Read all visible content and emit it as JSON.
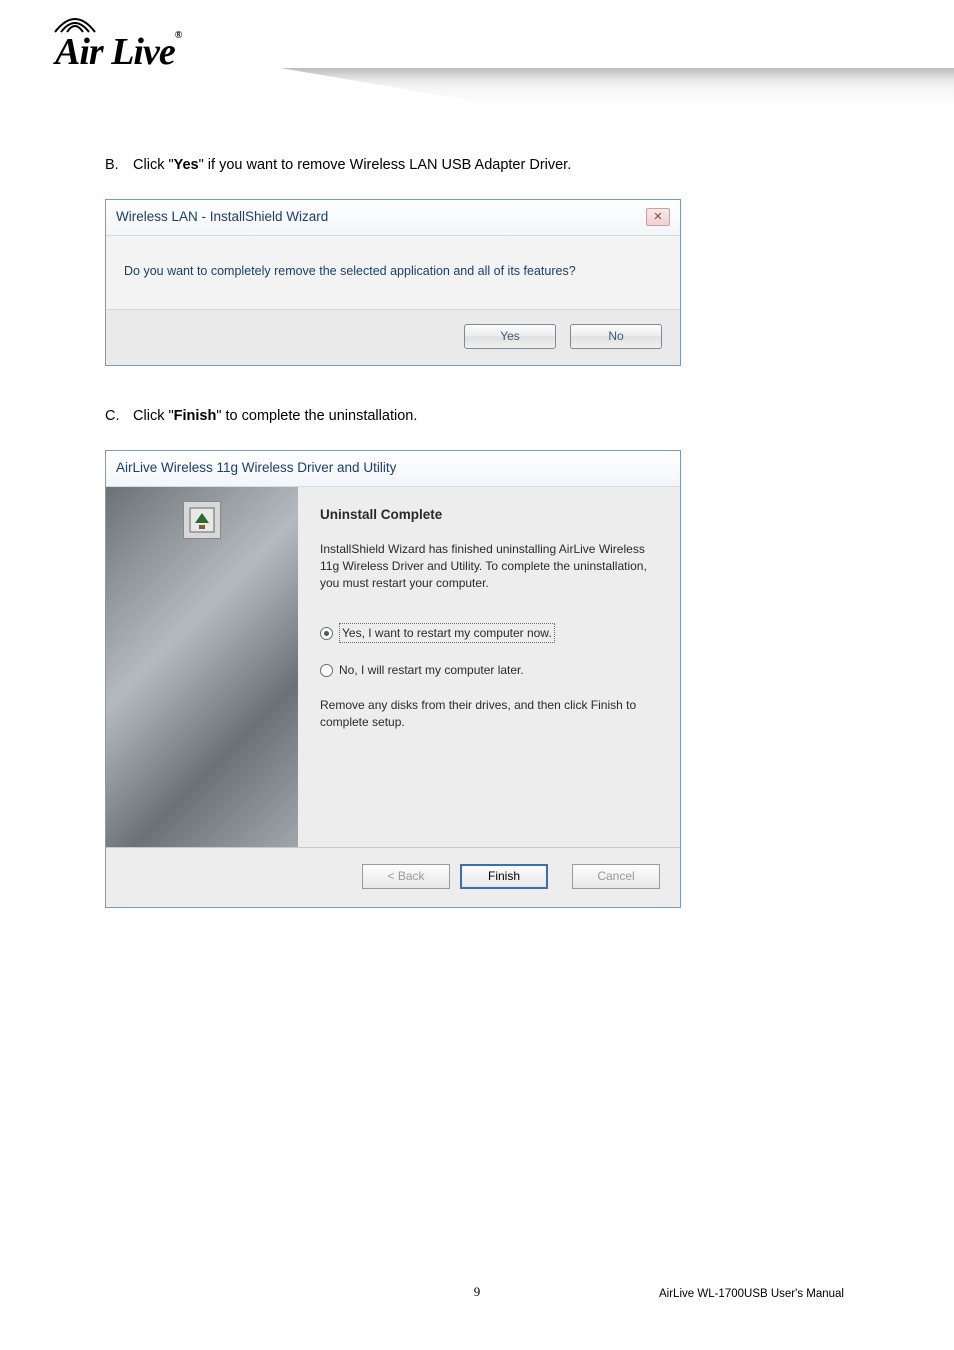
{
  "brand": {
    "name": "Air Live",
    "registered": "®"
  },
  "steps": {
    "b": {
      "letter": "B.",
      "prefix": "Click \"",
      "bold": "Yes",
      "suffix": "\" if you want to remove Wireless LAN USB Adapter Driver."
    },
    "c": {
      "letter": "C.",
      "prefix": "Click \"",
      "bold": "Finish",
      "suffix": "\" to complete the uninstallation."
    }
  },
  "dialog1": {
    "title": "Wireless LAN - InstallShield Wizard",
    "close": "✕",
    "message": "Do you want to completely remove the selected application and all of its features?",
    "yes": "Yes",
    "no": "No"
  },
  "dialog2": {
    "title": "AirLive Wireless 11g Wireless Driver and Utility",
    "heading": "Uninstall Complete",
    "body": "InstallShield Wizard has finished uninstalling AirLive Wireless 11g Wireless Driver and Utility.  To complete the uninstallation, you must restart your computer.",
    "opt_yes": "Yes, I want to restart my computer now.",
    "opt_no": "No, I will restart my computer later.",
    "remove": "Remove any disks from their drives, and then click Finish to complete setup.",
    "back": "< Back",
    "finish": "Finish",
    "cancel": "Cancel"
  },
  "footer": {
    "page": "9",
    "manual": "AirLive WL-1700USB User's Manual"
  }
}
